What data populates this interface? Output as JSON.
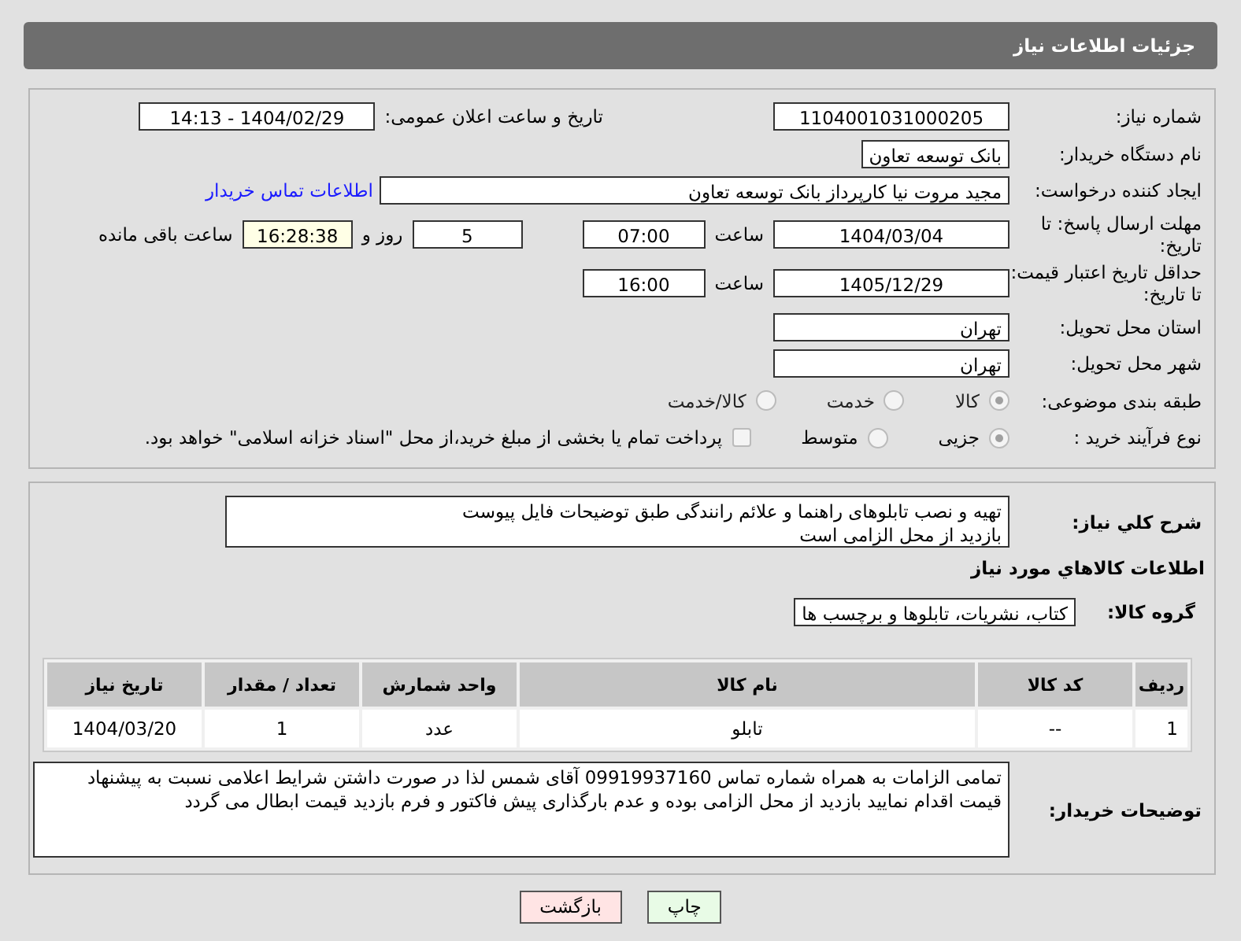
{
  "title": "جزئیات اطلاعات نیاز",
  "need_number": {
    "label": "شماره نیاز:",
    "value": "1104001031000205"
  },
  "announce": {
    "label": "تاریخ و ساعت اعلان عمومی:",
    "value": "1404/02/29 - 14:13"
  },
  "buyer_org": {
    "label": "نام دستگاه خریدار:",
    "value": "بانک توسعه تعاون"
  },
  "requester": {
    "label": "ایجاد کننده درخواست:",
    "value": "مجید مروت نیا کارپرداز بانک توسعه تعاون",
    "link": "اطلاعات تماس خریدار"
  },
  "response_deadline": {
    "label": "مهلت ارسال پاسخ: تا تاریخ:",
    "date": "1404/03/04",
    "time_label": "ساعت",
    "time": "07:00",
    "days": "5",
    "days_label": "روز و",
    "remaining": "16:28:38",
    "remaining_label": "ساعت باقی مانده"
  },
  "price_validity": {
    "label": "حداقل تاریخ اعتبار قیمت: تا تاریخ:",
    "date": "1405/12/29",
    "time_label": "ساعت",
    "time": "16:00"
  },
  "province": {
    "label": "استان محل تحویل:",
    "value": "تهران"
  },
  "city": {
    "label": "شهر محل تحویل:",
    "value": "تهران"
  },
  "category": {
    "label": "طبقه بندی موضوعی:",
    "options": [
      {
        "label": "کالا",
        "selected": true
      },
      {
        "label": "خدمت",
        "selected": false
      },
      {
        "label": "کالا/خدمت",
        "selected": false
      }
    ]
  },
  "purchase_process": {
    "label": "نوع فرآیند خرید :",
    "options": [
      {
        "label": "جزیی",
        "selected": true
      },
      {
        "label": "متوسط",
        "selected": false
      }
    ],
    "treasury": {
      "label": "پرداخت تمام یا بخشی از مبلغ خرید،از محل \"اسناد خزانه اسلامی\" خواهد بود.",
      "checked": false
    }
  },
  "description": {
    "label": "شرح کلي نياز:",
    "value": "تهیه و نصب تابلوهای راهنما و علائم رانندگی طبق توضیحات فایل پیوست\nبازدید از محل الزامی است"
  },
  "items_heading": "اطلاعات کالاهاي مورد نياز",
  "goods_group": {
    "label": "گروه کالا:",
    "value": "کتاب، نشریات، تابلوها و برچسب ها"
  },
  "table": {
    "columns": [
      "ردیف",
      "کد کالا",
      "نام کالا",
      "واحد شمارش",
      "تعداد / مقدار",
      "تاریخ نیاز"
    ],
    "rows": [
      [
        "1",
        "--",
        "تابلو",
        "عدد",
        "1",
        "1404/03/20"
      ]
    ]
  },
  "buyer_notes": {
    "label": "توضیحات خریدار:",
    "value": "تمامی الزامات به همراه شماره تماس 09919937160 آقای شمس لذا در صورت داشتن شرایط اعلامی نسبت به پیشنهاد قیمت اقدام نمایید بازدید از محل الزامی بوده و عدم بارگذاری پیش فاکتور و فرم بازدید قیمت ابطال می گردد"
  },
  "buttons": [
    {
      "label": "چاپ",
      "kind": "print"
    },
    {
      "label": "بازگشت",
      "kind": "back"
    }
  ]
}
